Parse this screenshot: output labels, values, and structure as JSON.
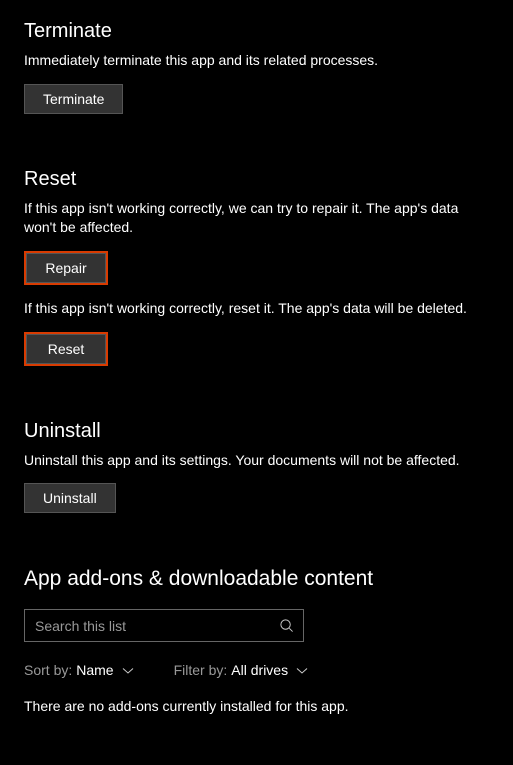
{
  "terminate": {
    "heading": "Terminate",
    "desc": "Immediately terminate this app and its related processes.",
    "button": "Terminate"
  },
  "reset": {
    "heading": "Reset",
    "repair_desc": "If this app isn't working correctly, we can try to repair it. The app's data won't be affected.",
    "repair_button": "Repair",
    "reset_desc": "If this app isn't working correctly, reset it. The app's data will be deleted.",
    "reset_button": "Reset"
  },
  "uninstall": {
    "heading": "Uninstall",
    "desc": "Uninstall this app and its settings. Your documents will not be affected.",
    "button": "Uninstall"
  },
  "addons": {
    "heading": "App add-ons & downloadable content",
    "search_placeholder": "Search this list",
    "sort_label": "Sort by:",
    "sort_value": "Name",
    "filter_label": "Filter by:",
    "filter_value": "All drives",
    "empty_message": "There are no add-ons currently installed for this app."
  }
}
